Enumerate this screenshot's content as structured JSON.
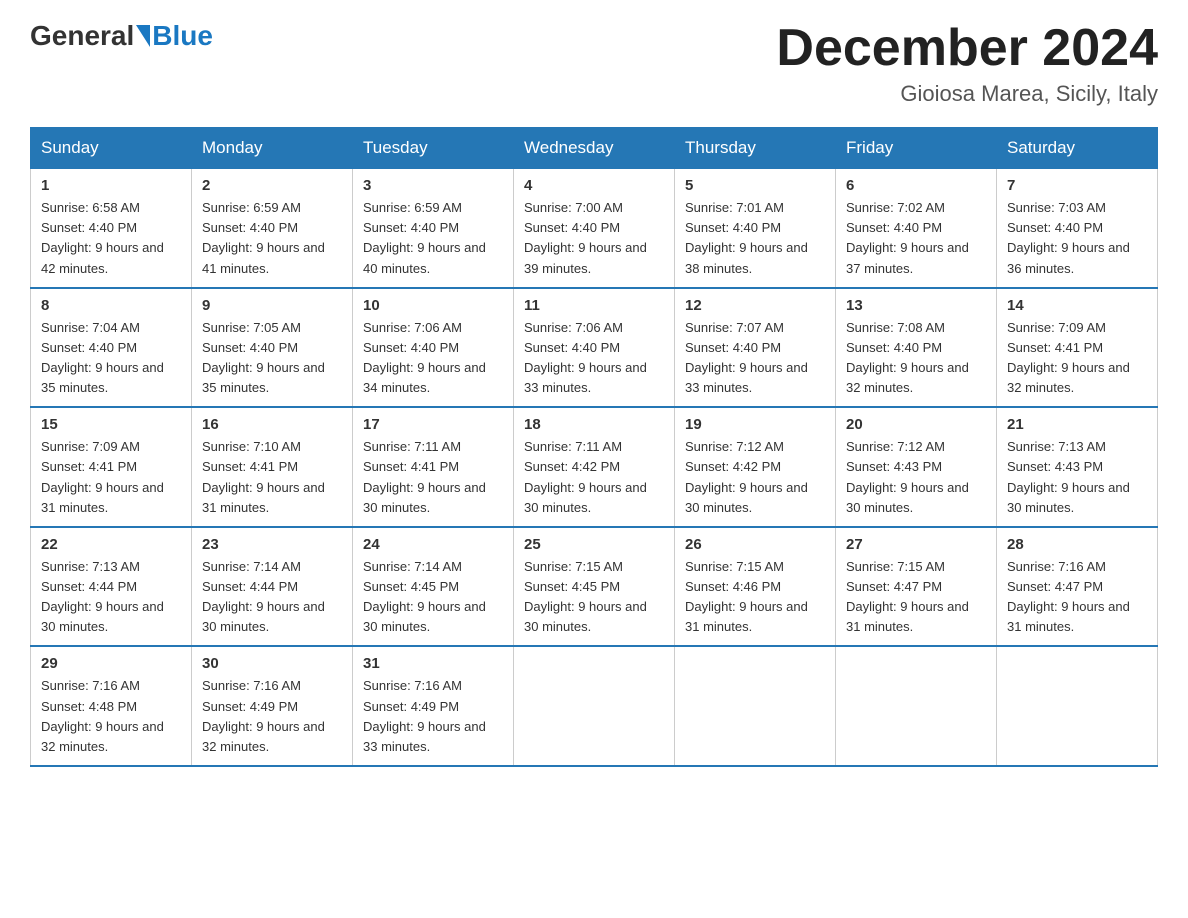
{
  "header": {
    "logo_general": "General",
    "logo_blue": "Blue",
    "month_title": "December 2024",
    "location": "Gioiosa Marea, Sicily, Italy"
  },
  "weekdays": [
    "Sunday",
    "Monday",
    "Tuesday",
    "Wednesday",
    "Thursday",
    "Friday",
    "Saturday"
  ],
  "weeks": [
    [
      {
        "day": "1",
        "sunrise": "6:58 AM",
        "sunset": "4:40 PM",
        "daylight": "9 hours and 42 minutes."
      },
      {
        "day": "2",
        "sunrise": "6:59 AM",
        "sunset": "4:40 PM",
        "daylight": "9 hours and 41 minutes."
      },
      {
        "day": "3",
        "sunrise": "6:59 AM",
        "sunset": "4:40 PM",
        "daylight": "9 hours and 40 minutes."
      },
      {
        "day": "4",
        "sunrise": "7:00 AM",
        "sunset": "4:40 PM",
        "daylight": "9 hours and 39 minutes."
      },
      {
        "day": "5",
        "sunrise": "7:01 AM",
        "sunset": "4:40 PM",
        "daylight": "9 hours and 38 minutes."
      },
      {
        "day": "6",
        "sunrise": "7:02 AM",
        "sunset": "4:40 PM",
        "daylight": "9 hours and 37 minutes."
      },
      {
        "day": "7",
        "sunrise": "7:03 AM",
        "sunset": "4:40 PM",
        "daylight": "9 hours and 36 minutes."
      }
    ],
    [
      {
        "day": "8",
        "sunrise": "7:04 AM",
        "sunset": "4:40 PM",
        "daylight": "9 hours and 35 minutes."
      },
      {
        "day": "9",
        "sunrise": "7:05 AM",
        "sunset": "4:40 PM",
        "daylight": "9 hours and 35 minutes."
      },
      {
        "day": "10",
        "sunrise": "7:06 AM",
        "sunset": "4:40 PM",
        "daylight": "9 hours and 34 minutes."
      },
      {
        "day": "11",
        "sunrise": "7:06 AM",
        "sunset": "4:40 PM",
        "daylight": "9 hours and 33 minutes."
      },
      {
        "day": "12",
        "sunrise": "7:07 AM",
        "sunset": "4:40 PM",
        "daylight": "9 hours and 33 minutes."
      },
      {
        "day": "13",
        "sunrise": "7:08 AM",
        "sunset": "4:40 PM",
        "daylight": "9 hours and 32 minutes."
      },
      {
        "day": "14",
        "sunrise": "7:09 AM",
        "sunset": "4:41 PM",
        "daylight": "9 hours and 32 minutes."
      }
    ],
    [
      {
        "day": "15",
        "sunrise": "7:09 AM",
        "sunset": "4:41 PM",
        "daylight": "9 hours and 31 minutes."
      },
      {
        "day": "16",
        "sunrise": "7:10 AM",
        "sunset": "4:41 PM",
        "daylight": "9 hours and 31 minutes."
      },
      {
        "day": "17",
        "sunrise": "7:11 AM",
        "sunset": "4:41 PM",
        "daylight": "9 hours and 30 minutes."
      },
      {
        "day": "18",
        "sunrise": "7:11 AM",
        "sunset": "4:42 PM",
        "daylight": "9 hours and 30 minutes."
      },
      {
        "day": "19",
        "sunrise": "7:12 AM",
        "sunset": "4:42 PM",
        "daylight": "9 hours and 30 minutes."
      },
      {
        "day": "20",
        "sunrise": "7:12 AM",
        "sunset": "4:43 PM",
        "daylight": "9 hours and 30 minutes."
      },
      {
        "day": "21",
        "sunrise": "7:13 AM",
        "sunset": "4:43 PM",
        "daylight": "9 hours and 30 minutes."
      }
    ],
    [
      {
        "day": "22",
        "sunrise": "7:13 AM",
        "sunset": "4:44 PM",
        "daylight": "9 hours and 30 minutes."
      },
      {
        "day": "23",
        "sunrise": "7:14 AM",
        "sunset": "4:44 PM",
        "daylight": "9 hours and 30 minutes."
      },
      {
        "day": "24",
        "sunrise": "7:14 AM",
        "sunset": "4:45 PM",
        "daylight": "9 hours and 30 minutes."
      },
      {
        "day": "25",
        "sunrise": "7:15 AM",
        "sunset": "4:45 PM",
        "daylight": "9 hours and 30 minutes."
      },
      {
        "day": "26",
        "sunrise": "7:15 AM",
        "sunset": "4:46 PM",
        "daylight": "9 hours and 31 minutes."
      },
      {
        "day": "27",
        "sunrise": "7:15 AM",
        "sunset": "4:47 PM",
        "daylight": "9 hours and 31 minutes."
      },
      {
        "day": "28",
        "sunrise": "7:16 AM",
        "sunset": "4:47 PM",
        "daylight": "9 hours and 31 minutes."
      }
    ],
    [
      {
        "day": "29",
        "sunrise": "7:16 AM",
        "sunset": "4:48 PM",
        "daylight": "9 hours and 32 minutes."
      },
      {
        "day": "30",
        "sunrise": "7:16 AM",
        "sunset": "4:49 PM",
        "daylight": "9 hours and 32 minutes."
      },
      {
        "day": "31",
        "sunrise": "7:16 AM",
        "sunset": "4:49 PM",
        "daylight": "9 hours and 33 minutes."
      },
      null,
      null,
      null,
      null
    ]
  ]
}
